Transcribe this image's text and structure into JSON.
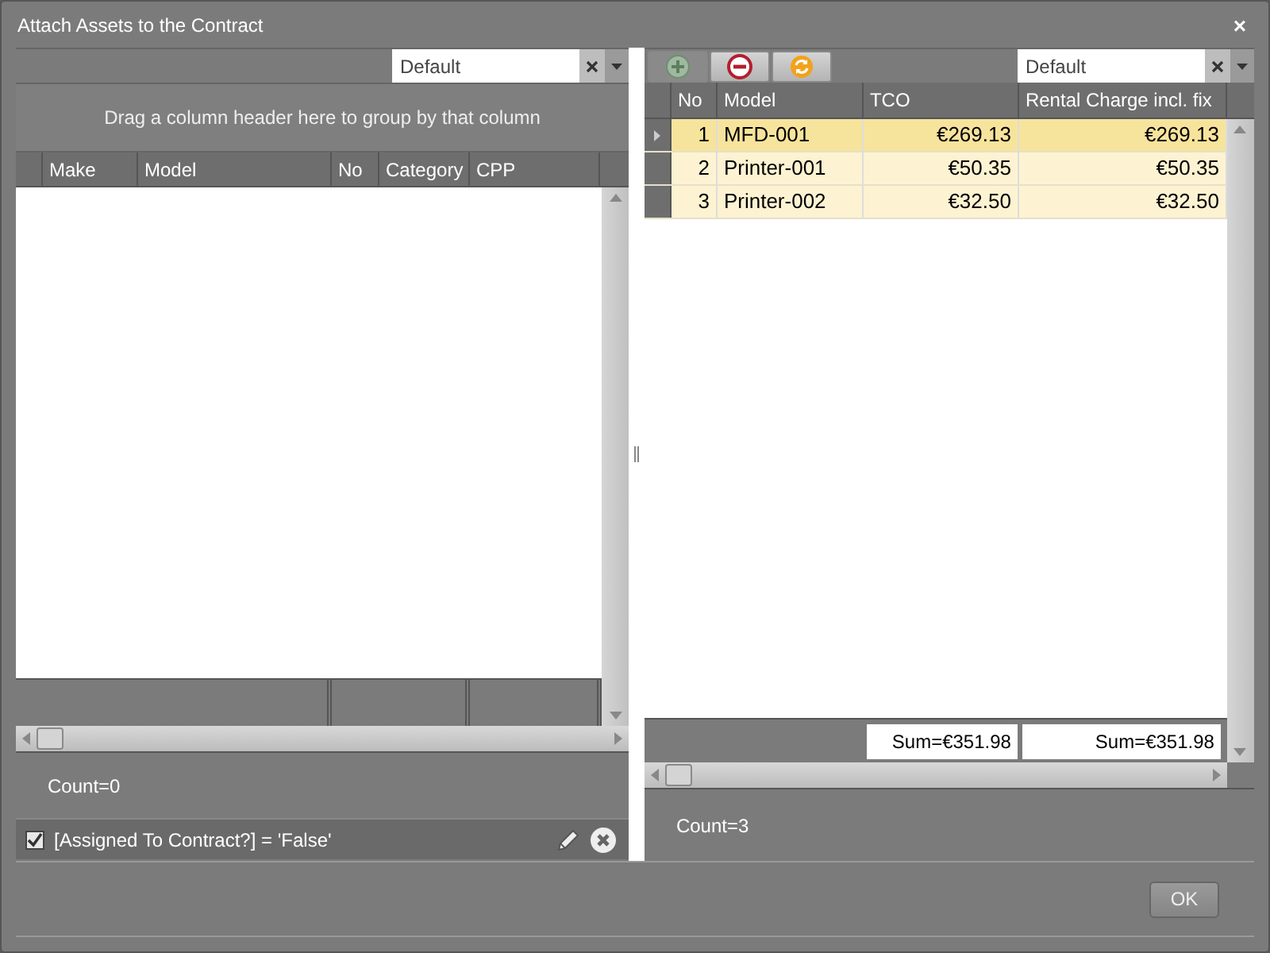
{
  "window": {
    "title": "Attach Assets to the Contract",
    "close": "×"
  },
  "left_grid": {
    "layout_select": {
      "value": "Default"
    },
    "group_panel_hint": "Drag a column header here to group by that column",
    "columns": [
      "Make",
      "Model",
      "No",
      "Category",
      "CPP"
    ],
    "count": "Count=0",
    "filter": {
      "checked": true,
      "text": "[Assigned To Contract?] = 'False'"
    }
  },
  "right_grid": {
    "toolbar": [
      {
        "kind": "add",
        "disabled": true
      },
      {
        "kind": "remove",
        "disabled": false
      },
      {
        "kind": "refresh",
        "disabled": false
      }
    ],
    "layout_select": {
      "value": "Default"
    },
    "columns": [
      "No",
      "Model",
      "TCO",
      "Rental Charge incl. fix"
    ],
    "rows": [
      {
        "no": "1",
        "model": "MFD-001",
        "tco": "€269.13",
        "rental": "€269.13",
        "selected": true
      },
      {
        "no": "2",
        "model": "Printer-001",
        "tco": "€50.35",
        "rental": "€50.35",
        "selected": false
      },
      {
        "no": "3",
        "model": "Printer-002",
        "tco": "€32.50",
        "rental": "€32.50",
        "selected": false
      }
    ],
    "sums": [
      "Sum=€351.98",
      "Sum=€351.98"
    ],
    "count": "Count=3"
  },
  "buttons": [
    "OK"
  ]
}
